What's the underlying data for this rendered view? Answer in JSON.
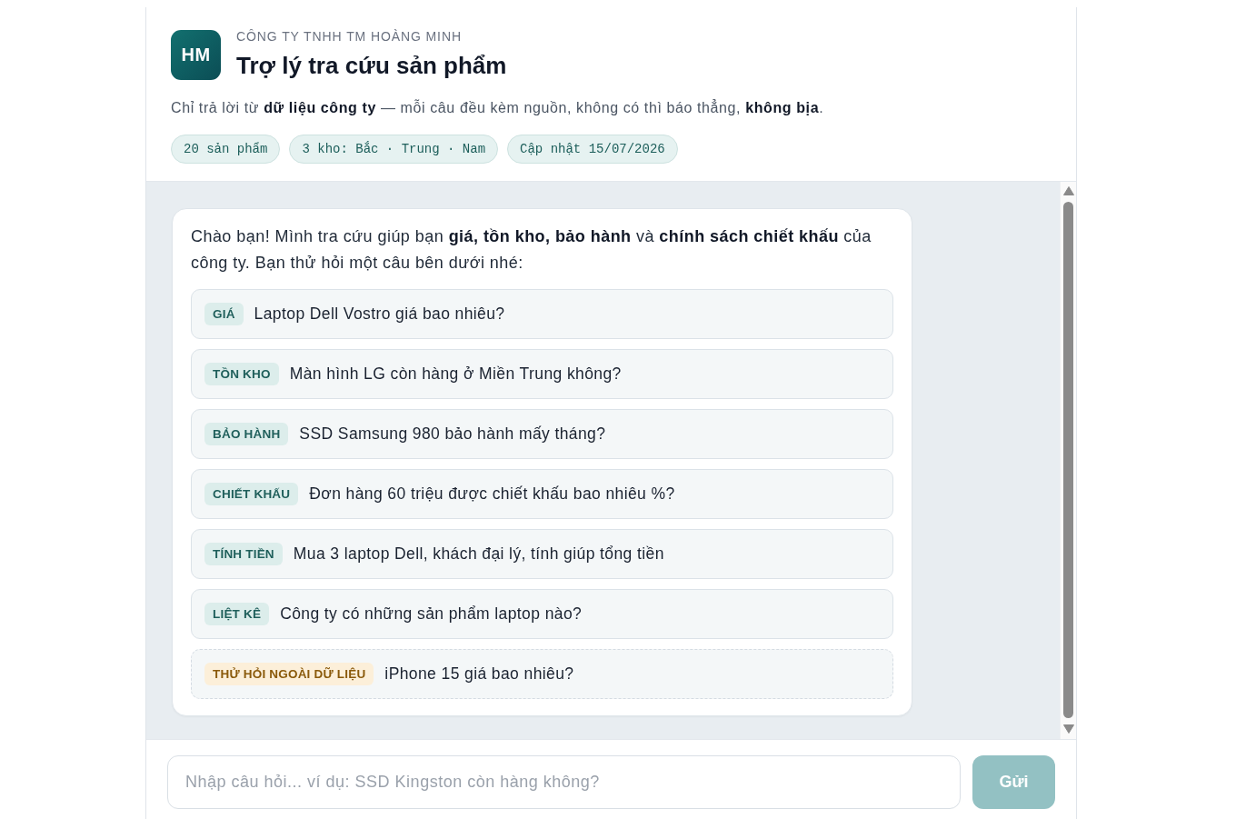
{
  "header": {
    "logo": "HM",
    "company": "CÔNG TY TNHH TM HOÀNG MINH",
    "title": "Trợ lý tra cứu sản phẩm",
    "description": "Chỉ trả lời từ **dữ liệu công ty** — mỗi câu đều kèm nguồn, không có thì báo thẳng, **không bịa**.",
    "stats": [
      "20 sản phẩm",
      "3 kho: Bắc · Trung · Nam",
      "Cập nhật 15/07/2026"
    ]
  },
  "chat": {
    "messages": [
      {
        "kind": "assistant",
        "text": "Chào bạn! Mình tra cứu giúp bạn **giá, tồn kho, bảo hành** và **chính sách chiết khấu** của công ty. Bạn thử hỏi một câu bên dưới nhé:",
        "suggestions": [
          {
            "kind": "data",
            "tag": "GIÁ",
            "question": "Laptop Dell Vostro giá bao nhiêu?"
          },
          {
            "kind": "data",
            "tag": "TỒN KHO",
            "question": "Màn hình LG còn hàng ở Miền Trung không?"
          },
          {
            "kind": "data",
            "tag": "BẢO HÀNH",
            "question": "SSD Samsung 980 bảo hành mấy tháng?"
          },
          {
            "kind": "data",
            "tag": "CHIẾT KHẤU",
            "question": "Đơn hàng 60 triệu được chiết khấu bao nhiêu %?"
          },
          {
            "kind": "data",
            "tag": "TÍNH TIỀN",
            "question": "Mua 3 laptop Dell, khách đại lý, tính giúp tổng tiền"
          },
          {
            "kind": "data",
            "tag": "LIỆT KÊ",
            "question": "Công ty có những sản phẩm laptop nào?"
          },
          {
            "kind": "outside",
            "tag": "THỬ HỎI NGOÀI DỮ LIỆU",
            "question": "iPhone 15 giá bao nhiêu?"
          }
        ]
      }
    ]
  },
  "composer": {
    "placeholder": "Nhập câu hỏi... ví dụ: SSD Kingston còn hàng không?",
    "send_button": "Gửi",
    "disabled": true
  }
}
